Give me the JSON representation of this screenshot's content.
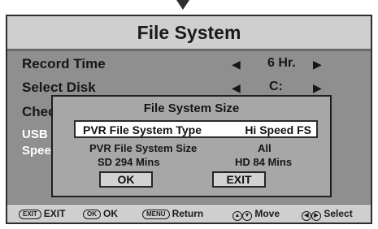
{
  "window": {
    "title": "File System"
  },
  "menu": {
    "record_time": {
      "label": "Record Time",
      "value": "6 Hr."
    },
    "select_disk": {
      "label": "Select Disk",
      "value": "C:"
    },
    "check": {
      "label": "Chec"
    },
    "usb": {
      "label": "USB"
    },
    "speed": {
      "label": "Spee"
    }
  },
  "dialog": {
    "title": "File System Size",
    "type_label": "PVR File System Type",
    "type_value": "Hi Speed FS",
    "size_label": "PVR File System Size",
    "size_value": "All",
    "sd": "SD 294 Mins",
    "hd": "HD 84 Mins",
    "ok": "OK",
    "exit": "EXIT"
  },
  "footer": {
    "exit_key": "EXIT",
    "exit_label": "EXIT",
    "ok_key": "OK",
    "ok_label": "OK",
    "menu_key": "MENU",
    "menu_label": "Return",
    "move_label": "Move",
    "select_label": "Select"
  },
  "colors": {
    "screen": "#8f8f8f",
    "title_bar": "#cfcfcf",
    "dialog": "#a7a7a7",
    "highlight": "#ffffff"
  }
}
